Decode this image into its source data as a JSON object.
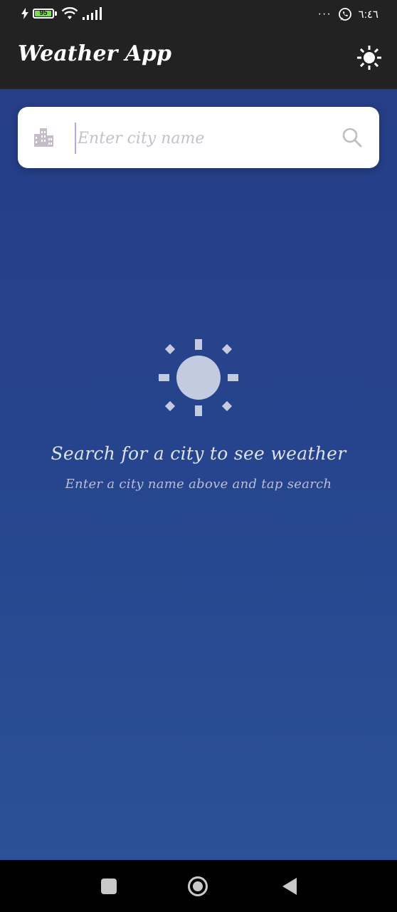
{
  "status_bar": {
    "battery_level": "95",
    "time": "٦:٤٦",
    "more_label": "···",
    "icons": [
      "charging-icon",
      "battery-icon",
      "wifi-icon",
      "signal-icon",
      "more-icon",
      "whatsapp-icon"
    ]
  },
  "app_bar": {
    "title": "Weather App",
    "theme_toggle_icon": "sun-icon"
  },
  "search": {
    "placeholder": "Enter city name",
    "value": "",
    "leading_icon": "city-icon",
    "trailing_icon": "search-icon"
  },
  "empty_state": {
    "icon": "sun-icon",
    "title": "Search for a city to see weather",
    "subtitle": "Enter a city name above and tap search"
  },
  "nav_bar": {
    "icons": [
      "recents-icon",
      "home-icon",
      "back-icon"
    ]
  },
  "colors": {
    "app_bar_bg": "#222222",
    "gradient_top": "#253e86",
    "gradient_bottom": "#2b5196",
    "card_bg": "#ffffff",
    "placeholder": "#c5c0cc",
    "empty_title": "#dde2f0",
    "empty_subtitle": "#b5bfdb"
  }
}
